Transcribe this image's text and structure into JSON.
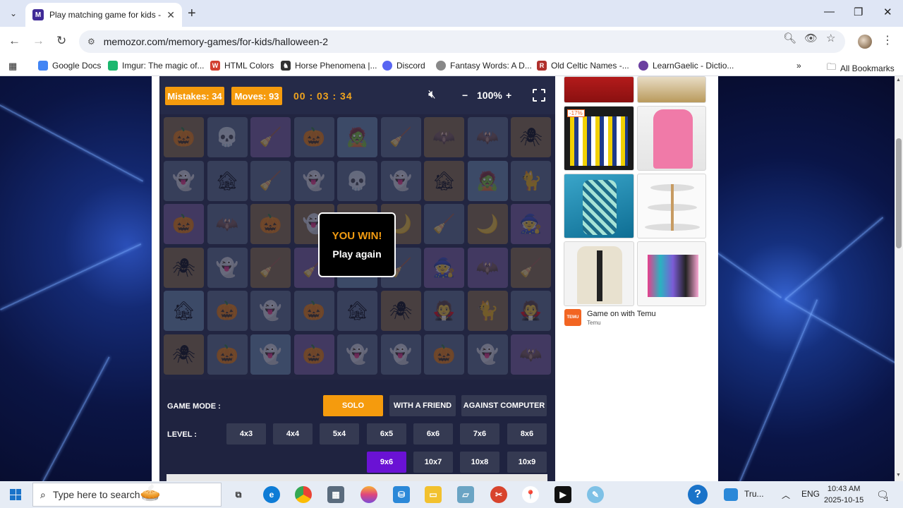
{
  "browser": {
    "tab_title": "Play matching game for kids - M",
    "favicon_letter": "M",
    "url": "memozor.com/memory-games/for-kids/halloween-2",
    "bookmarks": [
      {
        "label": "Google Docs",
        "color": "#4285f4"
      },
      {
        "label": "Imgur: The magic of...",
        "color": "#1bb76e"
      },
      {
        "label": "HTML Colors",
        "color": "#d23f31"
      },
      {
        "label": "Horse Phenomena |...",
        "color": "#333333"
      },
      {
        "label": "Discord",
        "color": "#5865f2"
      },
      {
        "label": "Fantasy Words: A D...",
        "color": "#888888"
      },
      {
        "label": "Old Celtic Names -...",
        "color": "#b0302c"
      },
      {
        "label": "LearnGaelic - Dictio...",
        "color": "#6b3fa0"
      }
    ],
    "all_bookmarks": "All Bookmarks"
  },
  "game": {
    "mistakes_label": "Mistakes: 34",
    "moves_label": "Moves: 93",
    "timer": "00 : 03 : 34",
    "zoom_minus": "−",
    "zoom_level": "100%",
    "zoom_plus": "+",
    "win_title": "YOU WIN!",
    "play_again": "Play again",
    "cards": [
      [
        "🎃",
        "💀",
        "🧹",
        "🎃",
        "🧟",
        "🧹",
        "🦇",
        "🦇",
        "🕷"
      ],
      [
        "👻",
        "🏚",
        "🧹",
        "👻",
        "💀",
        "👻",
        "🏚",
        "🧟",
        "🐈"
      ],
      [
        "🎃",
        "🦇",
        "🎃",
        "👻",
        "🌙",
        "🌙",
        "🧹",
        "🌙",
        "🧙"
      ],
      [
        "🕷",
        "👻",
        "🧹",
        "🧹",
        "🏚",
        "🧹",
        "🧙",
        "🦇",
        "🧹"
      ],
      [
        "🏚",
        "🎃",
        "👻",
        "🎃",
        "🏚",
        "🕷",
        "🧛",
        "🐈",
        "🧛"
      ],
      [
        "🕷",
        "🎃",
        "👻",
        "🎃",
        "👻",
        "👻",
        "🎃",
        "👻",
        "🦇"
      ]
    ],
    "card_colors": [
      [
        "#8a6a3e",
        "#5a6a85",
        "#7a5a9a",
        "#5a6a85",
        "#6a8aaa",
        "#5a6a85",
        "#8a6a3e",
        "#5a6a85",
        "#8a6a3e"
      ],
      [
        "#5a6a85",
        "#5a6a85",
        "#5a6a85",
        "#5a6a85",
        "#5a6a85",
        "#5a6a85",
        "#8a6a3e",
        "#6a8aaa",
        "#5a6a85"
      ],
      [
        "#7a5a9a",
        "#5a6a85",
        "#8a6a3e",
        "#8a6a3e",
        "#8a6a3e",
        "#8a6a3e",
        "#5a6a85",
        "#8a6a3e",
        "#7a5a9a"
      ],
      [
        "#8a6a3e",
        "#5a6a85",
        "#8a6a3e",
        "#7a5a9a",
        "#6a8aaa",
        "#5a6a85",
        "#7a5a9a",
        "#7a5a9a",
        "#8a6a3e"
      ],
      [
        "#6a8aaa",
        "#5a6a85",
        "#5a6a85",
        "#5a6a85",
        "#5a6a85",
        "#8a6a3e",
        "#5a6a85",
        "#8a6a3e",
        "#5a6a85"
      ],
      [
        "#8a6a3e",
        "#5a6a85",
        "#6a8aaa",
        "#7a5a9a",
        "#5a6a85",
        "#5a6a85",
        "#5a6a85",
        "#5a6a85",
        "#7a5a9a"
      ]
    ],
    "mode_label": "GAME MODE :",
    "modes": [
      {
        "label": "SOLO",
        "active": true
      },
      {
        "label": "WITH A FRIEND",
        "active": false
      },
      {
        "label": "AGAINST COMPUTER",
        "active": false
      }
    ],
    "level_label": "LEVEL :",
    "levels_row1": [
      "4x3",
      "4x4",
      "5x4",
      "6x5",
      "6x6",
      "7x6",
      "8x6"
    ],
    "levels_row2": [
      {
        "label": "9x6",
        "active": true
      },
      {
        "label": "10x7",
        "active": false
      },
      {
        "label": "10x8",
        "active": false
      },
      {
        "label": "10x9",
        "active": false
      }
    ]
  },
  "ad": {
    "discount": "-17%",
    "title": "Game on with Temu",
    "source": "Temu",
    "logo_text": "TEMU",
    "accent": "#f26522"
  },
  "taskbar": {
    "search_placeholder": "Type here to search",
    "tray_app": "Tru...",
    "language": "ENG",
    "time": "10:43 AM",
    "date": "2025-10-15",
    "notification_count": "1"
  },
  "colors": {
    "orange": "#f59b0d",
    "purple": "#6a12d4",
    "board_bg": "#1f2340"
  }
}
